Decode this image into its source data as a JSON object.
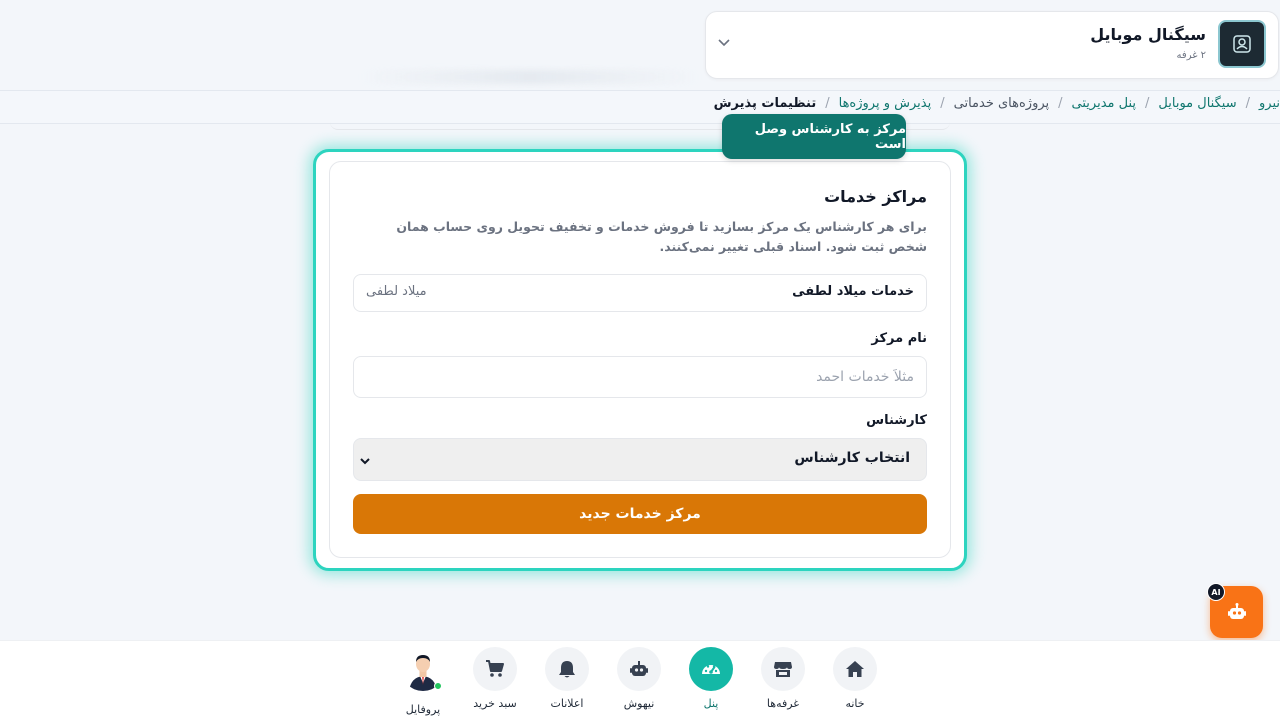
{
  "store": {
    "name": "سیگنال موبایل",
    "sub": "۲ غرفه"
  },
  "breadcrumb": {
    "items": [
      {
        "label": "نیرو",
        "type": "link"
      },
      {
        "label": "سیگنال موبایل",
        "type": "link"
      },
      {
        "label": "پنل مدیریتی",
        "type": "link"
      },
      {
        "label": "پروژه‌های خدماتی",
        "type": "plain"
      },
      {
        "label": "پذیرش و پروژه‌ها",
        "type": "link"
      },
      {
        "label": "تنظیمات پذیرش",
        "type": "current"
      }
    ],
    "separator": "/"
  },
  "toast": {
    "text": "مرکز به کارشناس وصل است"
  },
  "card": {
    "title": "مراکز خدمات",
    "description": "برای هر کارشناس یک مرکز بسازید تا فروش خدمات و تخفیف تحویل روی حساب همان شخص ثبت شود. اسناد قبلی تغییر نمی‌کنند.",
    "existing_center": {
      "name": "خدمات میلاد لطفی",
      "owner": "میلاد لطفی"
    },
    "name_field": {
      "label": "نام مرکز",
      "value": "",
      "placeholder": "مثلاً خدمات احمد"
    },
    "expert_field": {
      "label": "کارشناس",
      "selected": "انتخاب کارشناس"
    },
    "submit_label": "مرکز خدمات جدید"
  },
  "ai": {
    "badge": "AI"
  },
  "nav": {
    "items": [
      {
        "label": "خانه",
        "icon": "home-icon"
      },
      {
        "label": "غرفه‌ها",
        "icon": "store-icon"
      },
      {
        "label": "پنل",
        "icon": "dashboard-icon",
        "active": true
      },
      {
        "label": "نیهوش",
        "icon": "robot-icon"
      },
      {
        "label": "اعلانات",
        "icon": "bell-icon"
      },
      {
        "label": "سبد خرید",
        "icon": "cart-icon"
      },
      {
        "label": "پروفایل",
        "icon": "avatar"
      }
    ]
  },
  "colors": {
    "accent": "#14b8a6",
    "primary_button": "#d97706",
    "toast": "#0f766e",
    "ai_button": "#f97316"
  }
}
